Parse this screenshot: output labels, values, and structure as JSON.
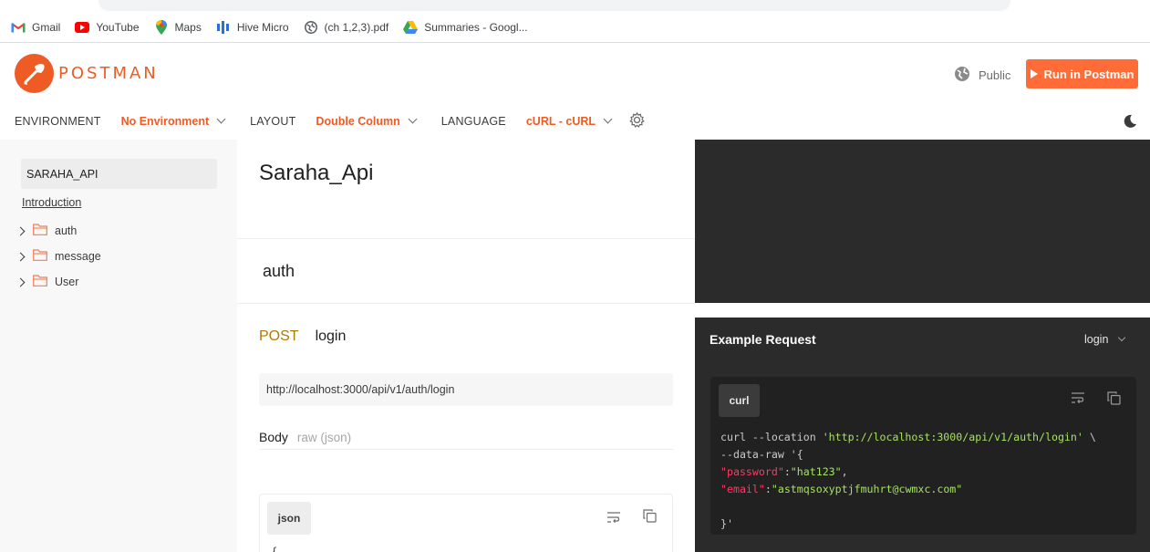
{
  "browser": {
    "bookmarks": [
      {
        "label": "Gmail",
        "icon": "gmail-icon"
      },
      {
        "label": "YouTube",
        "icon": "youtube-icon"
      },
      {
        "label": "Maps",
        "icon": "maps-icon"
      },
      {
        "label": "Hive Micro",
        "icon": "hive-icon"
      },
      {
        "label": "(ch 1,2,3).pdf",
        "icon": "pdf-globe-icon"
      },
      {
        "label": "Summaries - Googl...",
        "icon": "drive-icon"
      }
    ]
  },
  "header": {
    "logo_text": "POSTMAN",
    "visibility": "Public",
    "run_button": "Run in Postman",
    "brand_color": "#ff6c37"
  },
  "options": {
    "environment_label": "ENVIRONMENT",
    "environment_value": "No Environment",
    "layout_label": "LAYOUT",
    "layout_value": "Double Column",
    "language_label": "LANGUAGE",
    "language_value": "cURL - cURL"
  },
  "sidebar": {
    "collection": "SARAHA_API",
    "introduction": "Introduction",
    "folders": [
      {
        "label": "auth"
      },
      {
        "label": "message"
      },
      {
        "label": "User"
      }
    ]
  },
  "docs": {
    "title": "Saraha_Api",
    "folder_heading": "auth",
    "request": {
      "method": "POST",
      "name": "login",
      "url": "http://localhost:3000/api/v1/auth/login",
      "body_label": "Body",
      "body_type": "raw (json)",
      "json_chip": "json",
      "json_preview": "{"
    }
  },
  "example": {
    "title": "Example Request",
    "selected": "login",
    "lang_chip": "curl",
    "code": {
      "line1_cmd": "curl --location ",
      "line1_url": "'http://localhost:3000/api/v1/auth/login'",
      "line1_end": " \\",
      "line2": "--data-raw '{",
      "line3_key": "\"password\"",
      "line3_sep": ":",
      "line3_val": "\"hat123\"",
      "line3_end": ",",
      "line4_key": "\"email\"",
      "line4_sep": ":",
      "line4_val": "\"astmqsoxyptjfmuhrt@cwmxc.com\"",
      "line6": "}'"
    }
  }
}
